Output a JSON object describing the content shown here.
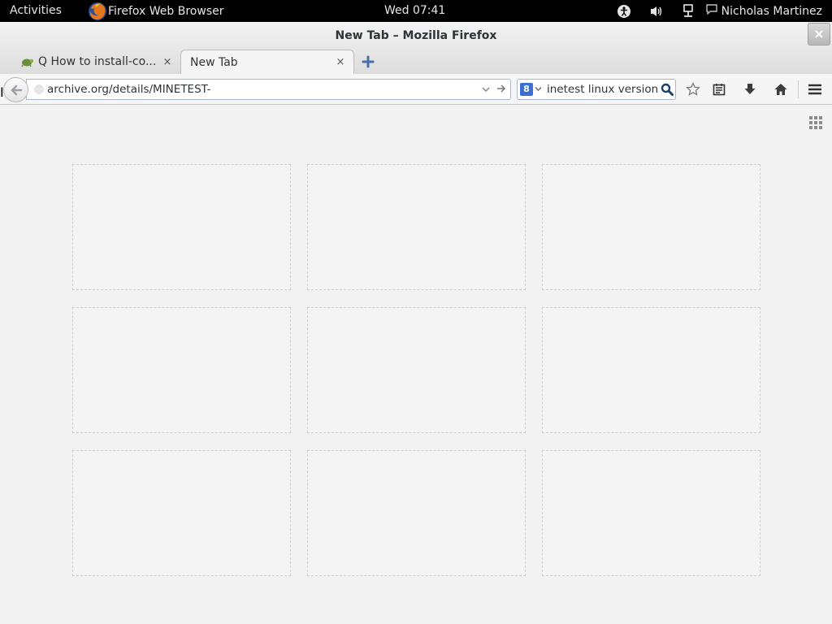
{
  "topbar": {
    "activities": "Activities",
    "app_name": "Firefox Web Browser",
    "clock": "Wed 07:41",
    "user": "Nicholas Martinez",
    "icons": [
      "accessibility-icon",
      "volume-icon",
      "network-icon",
      "chat-icon"
    ]
  },
  "window": {
    "title": "New Tab – Mozilla Firefox",
    "close_label": "×"
  },
  "tabs": [
    {
      "label": "Q How to install-co...",
      "icon": "tortoise-favicon",
      "close": "×",
      "active": false
    },
    {
      "label": "New Tab",
      "close": "×",
      "active": true
    }
  ],
  "navbar": {
    "url": "archive.org/details/MINETEST-",
    "search_value": "inetest linux versions",
    "search_engine_glyph": "8",
    "icons": [
      "back-icon",
      "bookmark-star-icon",
      "reading-list-icon",
      "download-icon",
      "home-icon",
      "menu-icon"
    ]
  },
  "content": {
    "tile_count": 9,
    "grid_toggle_icon": "grid-icon"
  },
  "colors": {
    "topbar_bg": "#000000",
    "content_bg": "#f2f2f2",
    "url_border": "#a9b7c9",
    "tile_border": "#cfcfcf"
  }
}
